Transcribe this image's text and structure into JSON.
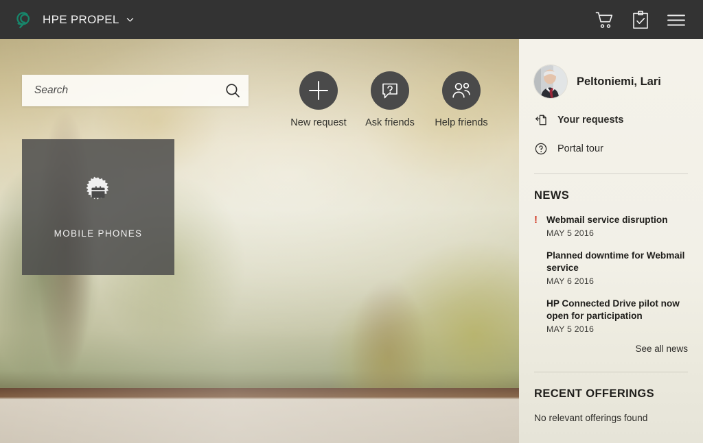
{
  "header": {
    "logo_icon": "propel-swirl-logo",
    "brand": "HPE PROPEL",
    "caret_icon": "chevron-down-icon",
    "actions": [
      {
        "icon": "shopping-cart-icon",
        "label": "Shopping cart"
      },
      {
        "icon": "clipboard-check-icon",
        "label": "Approvals"
      },
      {
        "icon": "hamburger-menu-icon",
        "label": "Menu"
      }
    ]
  },
  "hero": {
    "search": {
      "placeholder": "Search",
      "value": "",
      "icon": "search-icon"
    },
    "quick_actions": [
      {
        "icon": "plus-icon",
        "label": "New request"
      },
      {
        "icon": "question-speech-bubble-icon",
        "label": "Ask friends"
      },
      {
        "icon": "two-people-icon",
        "label": "Help friends"
      }
    ],
    "tiles": [
      {
        "icon": "briefcase-badge-icon",
        "label": "MOBILE PHONES"
      }
    ]
  },
  "sidebar": {
    "user": {
      "name": "Peltoniemi, Lari",
      "avatar": "user-avatar-photo"
    },
    "nav": [
      {
        "icon": "document-arrow-icon",
        "label": "Your requests",
        "bold": true
      },
      {
        "icon": "question-circle-icon",
        "label": "Portal tour",
        "bold": false
      }
    ],
    "news": {
      "title": "NEWS",
      "items": [
        {
          "alert": "!",
          "title": "Webmail service disruption",
          "date": "MAY 5 2016"
        },
        {
          "alert": "",
          "title": "Planned downtime for Webmail service",
          "date": "MAY 6 2016"
        },
        {
          "alert": "",
          "title": "HP Connected Drive pilot now open for participation",
          "date": "MAY 5 2016"
        }
      ],
      "see_all": "See all news"
    },
    "recent_offerings": {
      "title": "RECENT OFFERINGS",
      "empty_message": "No relevant offerings found"
    }
  },
  "colors": {
    "header_bg": "#333333",
    "brand_accent": "#17866b",
    "sidebar_bg": "#f3f1ea",
    "action_circle": "#4a4a4a",
    "tile_bg": "rgba(74,74,74,0.84)",
    "alert_red": "#d13b28"
  }
}
